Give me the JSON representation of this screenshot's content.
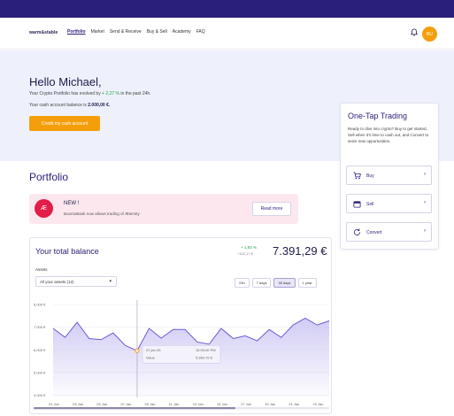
{
  "nav": {
    "logo": "warm&stable",
    "links": [
      "Portfolio",
      "Market",
      "Send & Receive",
      "Buy & Sell",
      "Academy",
      "FAQ"
    ],
    "avatar": "BU",
    "icons": [
      "bell-icon"
    ]
  },
  "hero": {
    "greeting": "Hello Michael,",
    "evolved_prefix": "Your Crypto Portfolio has evolved by",
    "evolved_pct": "+ 2,27 %",
    "evolved_suffix": "in the past 24h.",
    "cash_prefix": "Your cash account balance is",
    "cash_value": "2.000,00 €.",
    "credit_button": "Credit my cash account"
  },
  "portfolio": {
    "title": "Portfolio",
    "news": {
      "logo_text": "Æ",
      "title": "NEW !",
      "text": "BoursoBank now allows trading of Æternity",
      "button": "Read more"
    }
  },
  "balance": {
    "title": "Your total balance",
    "change_pct": "+ 1,83 %",
    "change_value": "+102,17 €",
    "amount": "7.391,29 €",
    "assets_label": "Assets",
    "assets_select": "All your assets (12)",
    "ranges": [
      "24h",
      "7 days",
      "30 days",
      "1 year"
    ],
    "active_range": "30 days",
    "tooltip": {
      "date": "07 jan 25",
      "time": "10:00:00 PM",
      "label": "Value",
      "value": "5.960,79 €"
    }
  },
  "chart_data": {
    "type": "area",
    "x": [
      "01 Jan",
      "02 Jan",
      "03 Jan",
      "04 Jan",
      "05 Jan",
      "06 Jan",
      "07 Jan",
      "08 Jan",
      "09 Jan",
      "10 Jan",
      "11 Jan",
      "12 Jan",
      "13 Jan",
      "14 Jan",
      "15 Jan",
      "16 Jan",
      "17 Jan",
      "18 Jan",
      "19 Jan",
      "20 Jan",
      "21 Jan",
      "22 Jan",
      "23 Jan",
      "24 Jan"
    ],
    "xticks": [
      "01 Jan",
      "03 Jan",
      "05 Jan",
      "07 Jan",
      "09 Jan",
      "11 Jan",
      "13 Jan",
      "15 Jan",
      "17 Jan",
      "19 Jan",
      "21 Jan",
      "23 Jan"
    ],
    "values": [
      6950,
      6550,
      7220,
      6500,
      6450,
      6750,
      6200,
      5960,
      6950,
      6520,
      6900,
      6900,
      6350,
      6250,
      6950,
      6500,
      6620,
      6400,
      6900,
      6550,
      7100,
      7400,
      7100,
      7280
    ],
    "ylim": [
      3900,
      8200
    ],
    "yticks": [
      4000,
      5000,
      6000,
      7000,
      8000
    ],
    "ytick_labels": [
      "4.000 €",
      "5.000 €",
      "6.000 €",
      "7.000 €",
      "8.000 €"
    ],
    "highlight_index": 7,
    "colors": {
      "line": "#6b5bd6",
      "fill": "#c9c3f2"
    }
  },
  "side": {
    "title": "One-Tap Trading",
    "text": "Ready to dive into crypto? Buy to get started, Sell when it's time to cash out, and Convert to seize new opportunities.",
    "actions": [
      {
        "label": "Buy",
        "icon": "cart-icon"
      },
      {
        "label": "Sell",
        "icon": "wallet-icon"
      },
      {
        "label": "Convert",
        "icon": "refresh-icon"
      }
    ]
  }
}
